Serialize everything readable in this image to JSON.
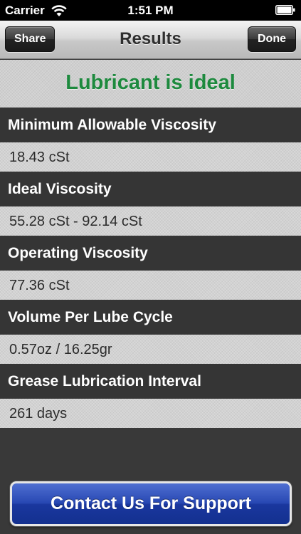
{
  "status_bar": {
    "carrier": "Carrier",
    "time": "1:51 PM"
  },
  "nav": {
    "title": "Results",
    "share_label": "Share",
    "done_label": "Done"
  },
  "result_status": "Lubricant is ideal",
  "colors": {
    "result_status": "#1d8a3e",
    "contact_button": "#2848b3"
  },
  "results": [
    {
      "label": "Minimum Allowable Viscosity",
      "value": "18.43 cSt"
    },
    {
      "label": "Ideal Viscosity",
      "value": "55.28 cSt - 92.14 cSt"
    },
    {
      "label": "Operating Viscosity",
      "value": "77.36 cSt"
    },
    {
      "label": "Volume Per Lube Cycle",
      "value": "0.57oz / 16.25gr"
    },
    {
      "label": "Grease Lubrication Interval",
      "value": "261 days"
    }
  ],
  "contact_button_label": "Contact Us For Support"
}
